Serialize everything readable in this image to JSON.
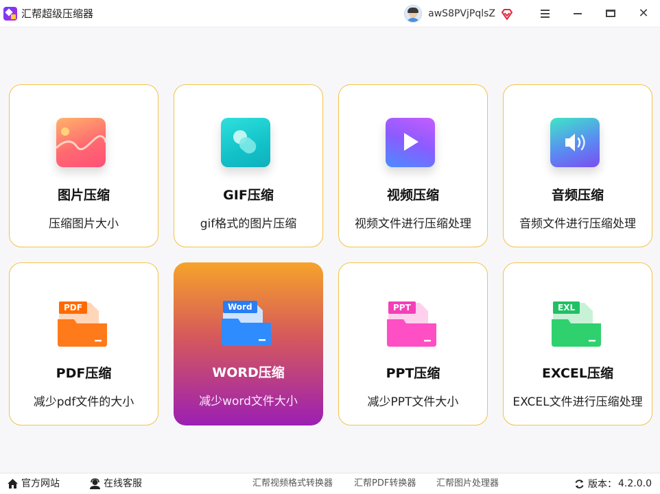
{
  "app": {
    "title": "汇帮超级压缩器"
  },
  "user": {
    "name": "awS8PVjPqlsZ"
  },
  "cards": [
    {
      "title": "图片压缩",
      "desc": "压缩图片大小",
      "icon": "image-icon"
    },
    {
      "title": "GIF压缩",
      "desc": "gif格式的图片压缩",
      "icon": "gif-icon"
    },
    {
      "title": "视频压缩",
      "desc": "视频文件进行压缩处理",
      "icon": "video-icon"
    },
    {
      "title": "音频压缩",
      "desc": "音频文件进行压缩处理",
      "icon": "audio-icon"
    },
    {
      "title": "PDF压缩",
      "desc": "减少pdf文件的大小",
      "icon": "pdf-folder-icon",
      "tag": "PDF"
    },
    {
      "title": "WORD压缩",
      "desc": "减少word文件大小",
      "icon": "word-folder-icon",
      "tag": "Word",
      "active": true
    },
    {
      "title": "PPT压缩",
      "desc": "减少PPT文件大小",
      "icon": "ppt-folder-icon",
      "tag": "PPT"
    },
    {
      "title": "EXCEL压缩",
      "desc": "EXCEL文件进行压缩处理",
      "icon": "excel-folder-icon",
      "tag": "EXL"
    }
  ],
  "footer": {
    "website": "官方网站",
    "support": "在线客服",
    "links": [
      "汇帮视频格式转换器",
      "汇帮PDF转换器",
      "汇帮图片处理器"
    ],
    "version_label": "版本：",
    "version": "4.2.0.0"
  },
  "colors": {
    "accent_border": "#f2c24a",
    "active_top": "#f6a32a",
    "active_bottom": "#9b1fb3"
  }
}
